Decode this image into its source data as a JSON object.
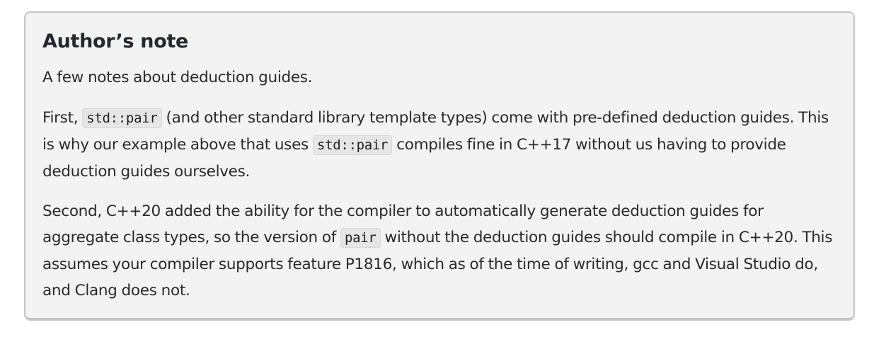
{
  "note": {
    "title": "Author’s note",
    "intro": "A few notes about deduction guides.",
    "p1": {
      "t1": "First, ",
      "c1": "std::pair",
      "t2": " (and other standard library template types) come with pre-defined deduction guides. This is why our example above that uses ",
      "c2": "std::pair",
      "t3": " compiles fine in C++17 without us having to provide deduction guides ourselves."
    },
    "p2": {
      "t1": "Second, C++20 added the ability for the compiler to automatically generate deduction guides for aggregate class types, so the version of ",
      "c1": "pair",
      "t2": " without the deduction guides should compile in C++20. This assumes your compiler supports feature P1816, which as of the time of writing, gcc and Visual Studio do, and Clang does not."
    }
  }
}
